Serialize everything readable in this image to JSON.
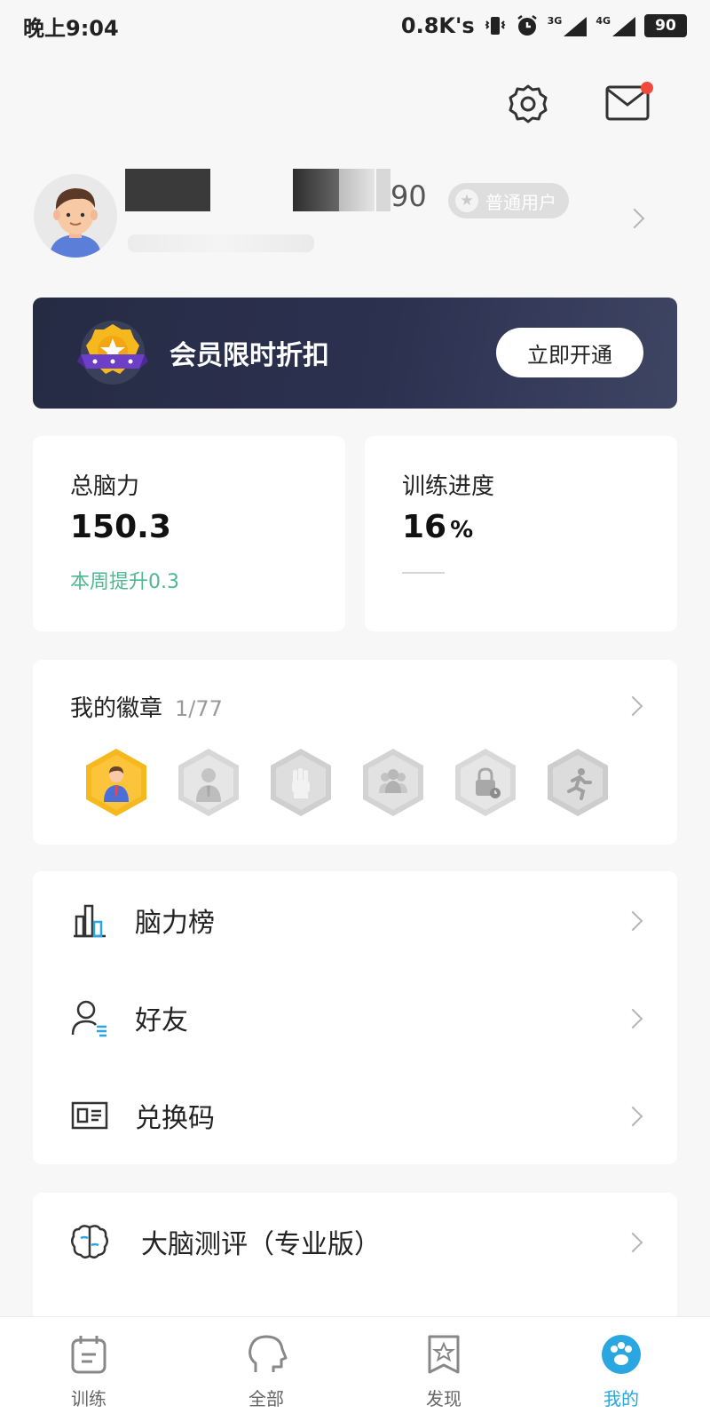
{
  "status_bar": {
    "time": "晚上9:04",
    "speed": "0.8K's",
    "sig1": "3G",
    "sig2": "4G",
    "battery": "90"
  },
  "profile": {
    "name_tail": "90",
    "badge": "普通用户"
  },
  "vip": {
    "title": "会员限时折扣",
    "button": "立即开通"
  },
  "stats": {
    "brain": {
      "label": "总脑力",
      "value": "150.3",
      "sub": "本周提升0.3"
    },
    "progress": {
      "label": "训练进度",
      "value": "16",
      "unit": "%",
      "fraction": 0.16
    }
  },
  "badges": {
    "title": "我的徽章",
    "count": "1/77",
    "items": [
      {
        "icon": "person-badge-icon",
        "earned": true
      },
      {
        "icon": "suit-badge-icon",
        "earned": false
      },
      {
        "icon": "fist-badge-icon",
        "earned": false
      },
      {
        "icon": "group-badge-icon",
        "earned": false
      },
      {
        "icon": "lock-badge-icon",
        "earned": false
      },
      {
        "icon": "runner-badge-icon",
        "earned": false
      }
    ]
  },
  "menu": [
    {
      "label": "脑力榜",
      "icon": "bar-chart-icon"
    },
    {
      "label": "好友",
      "icon": "friend-icon"
    },
    {
      "label": "兑换码",
      "icon": "id-card-icon"
    }
  ],
  "menu2": [
    {
      "label": "大脑测评（专业版）",
      "icon": "brain-icon"
    }
  ],
  "bottom_nav": [
    {
      "label": "训练",
      "icon": "calendar-icon",
      "active": false
    },
    {
      "label": "全部",
      "icon": "head-icon",
      "active": false
    },
    {
      "label": "发现",
      "icon": "bookmark-star-icon",
      "active": false
    },
    {
      "label": "我的",
      "icon": "paw-icon",
      "active": true
    }
  ],
  "colors": {
    "accent": "#2aa6e0",
    "green": "#4fb890",
    "vip_bg": "#262b44",
    "badge_gold": "#f6b91d"
  }
}
